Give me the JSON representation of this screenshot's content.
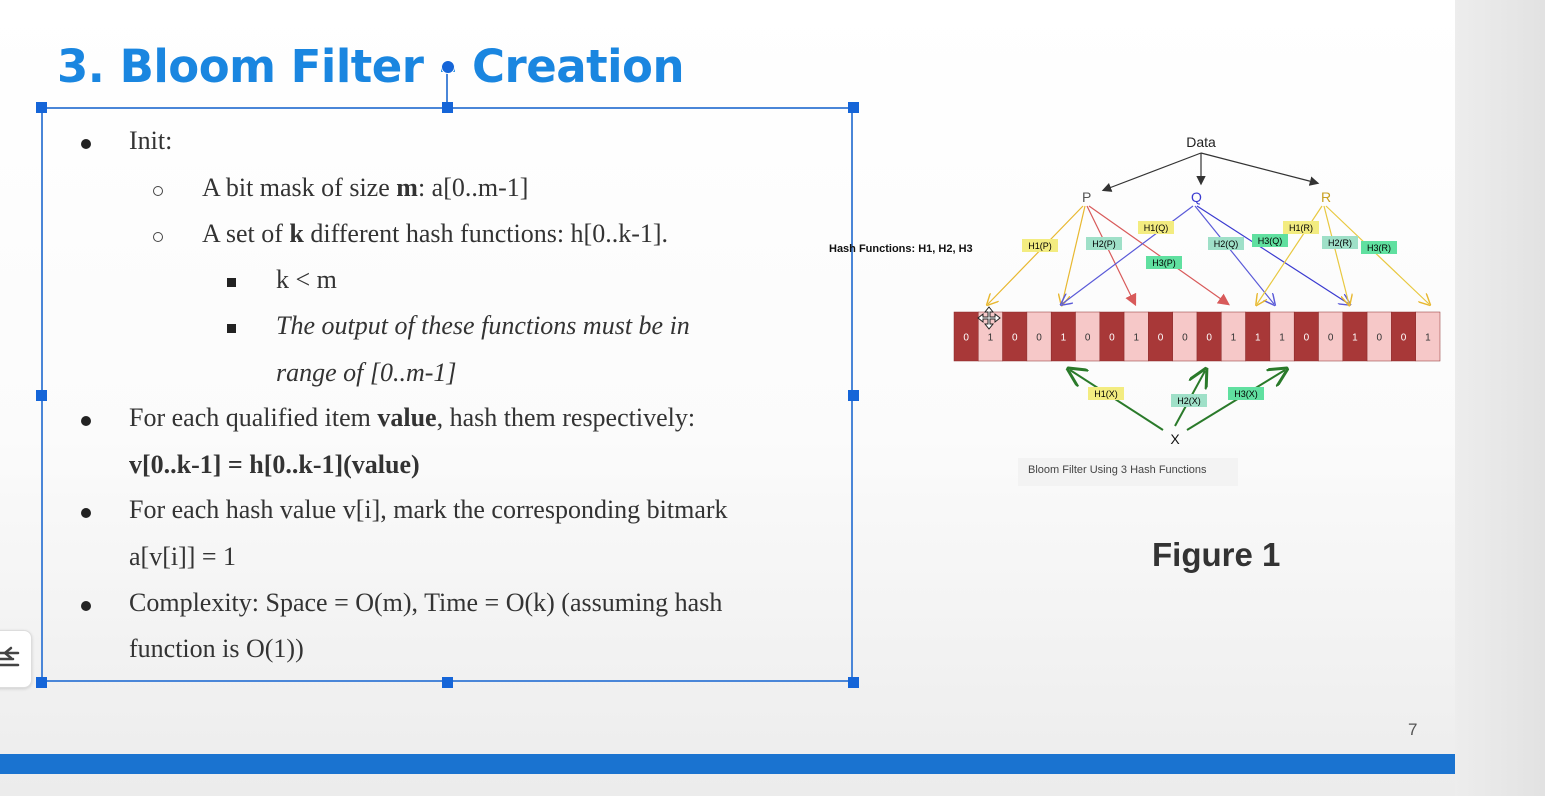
{
  "slide": {
    "title": "3. Bloom Filter - Creation",
    "page_number": "7",
    "figure_label": "Figure 1",
    "accent_color": "#1a86e0",
    "bar_color": "#1a73d0"
  },
  "content": {
    "init": "Init:",
    "bit_mask_pre": "A bit mask of size ",
    "bit_mask_bold": "m",
    "bit_mask_post": ": a[0..m-1]",
    "hash_set_pre": "A set of ",
    "hash_set_bold": "k",
    "hash_set_post": " different hash functions: h[0..k-1].",
    "k_lt_m": "k < m",
    "output_line1": "The output of these functions must be in",
    "output_line2": "range of [0..m-1]",
    "qualified_pre": "For each qualified item ",
    "qualified_bold": "value",
    "qualified_post": ", hash them respectively:",
    "hash_formula": "v[0..k-1] = h[0..k-1](value)",
    "mark_line1": "For each hash value v[i], mark the corresponding bitmark",
    "mark_line2": "a[v[i]] = 1",
    "complexity_line1": "Complexity: Space = O(m), Time = O(k) (assuming hash",
    "complexity_line2": "function is O(1))"
  },
  "figure": {
    "data_label": "Data",
    "nodes": [
      "P",
      "Q",
      "R"
    ],
    "hash_functions_label": "Hash Functions: H1, H2, H3",
    "p_labels": [
      "H1(P)",
      "H2(P)",
      "H3(P)"
    ],
    "q_labels": [
      "H1(Q)",
      "H2(Q)",
      "H3(Q)"
    ],
    "r_labels": [
      "H1(R)",
      "H2(R)",
      "H3(R)"
    ],
    "bits": [
      "0",
      "1",
      "0",
      "0",
      "1",
      "0",
      "0",
      "1",
      "0",
      "0",
      "0",
      "1",
      "1",
      "1",
      "0",
      "0",
      "1",
      "0",
      "0",
      "1"
    ],
    "x_label": "X",
    "x_labels": [
      "H1(X)",
      "H2(X)",
      "H3(X)"
    ],
    "caption": "Bloom Filter Using 3 Hash Functions"
  }
}
